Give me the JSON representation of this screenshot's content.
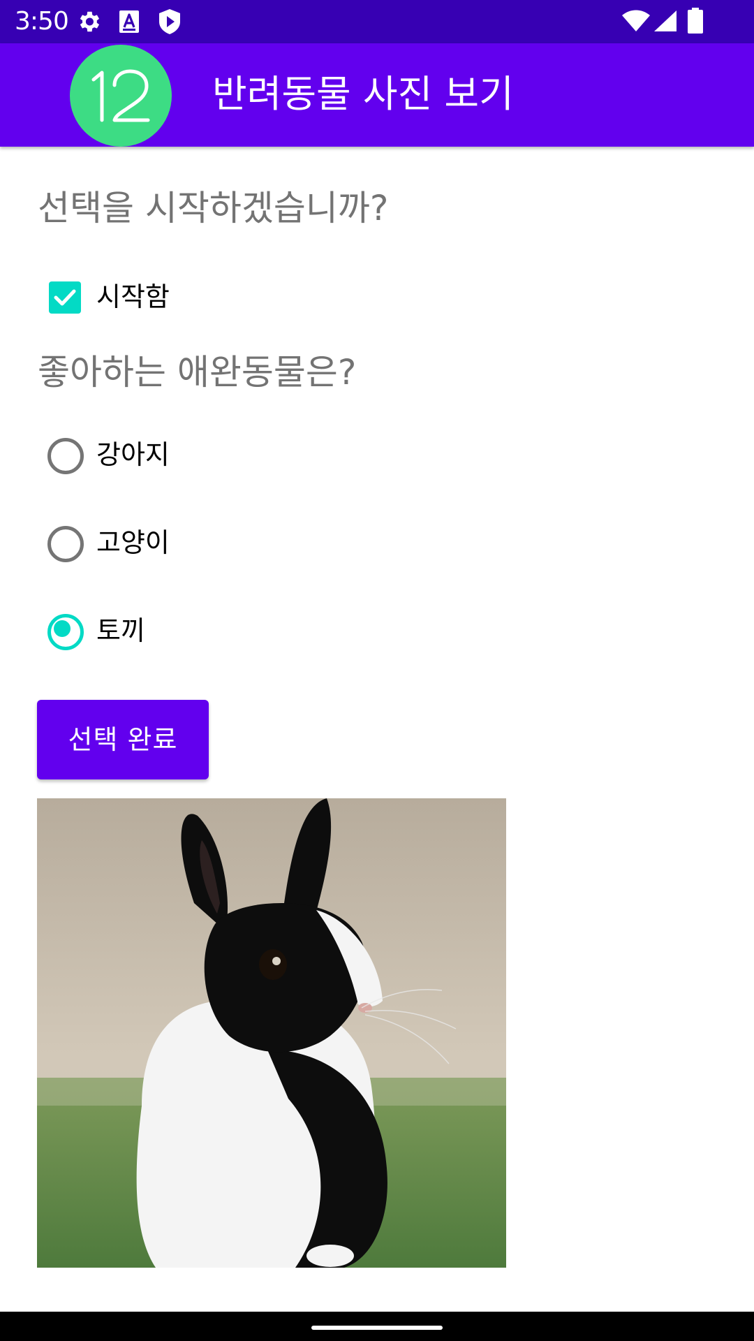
{
  "status_bar": {
    "time": "3:50",
    "left_icons": [
      "gear-icon",
      "a-text-icon",
      "shield-play-icon"
    ],
    "right_icons": [
      "wifi-icon",
      "cellular-signal-icon",
      "battery-icon"
    ],
    "background": "#3700b3"
  },
  "app_bar": {
    "logo_text": "12",
    "title": "반려동물 사진 보기",
    "background": "#6200ee",
    "logo_color": "#3ddc84"
  },
  "start_section": {
    "question": "선택을 시작하겠습니까?",
    "checkbox": {
      "label": "시작함",
      "checked": true
    }
  },
  "pet_section": {
    "question": "좋아하는 애완동물은?",
    "options": [
      {
        "label": "강아지",
        "selected": false
      },
      {
        "label": "고양이",
        "selected": false
      },
      {
        "label": "토끼",
        "selected": true
      }
    ]
  },
  "done_button": {
    "label": "선택 완료"
  },
  "pet_image": {
    "subject": "black-and-white-rabbit"
  },
  "colors": {
    "accent": "#03dac5",
    "primary": "#6200ee",
    "primary_dark": "#3700b3",
    "question_text": "#737373"
  }
}
